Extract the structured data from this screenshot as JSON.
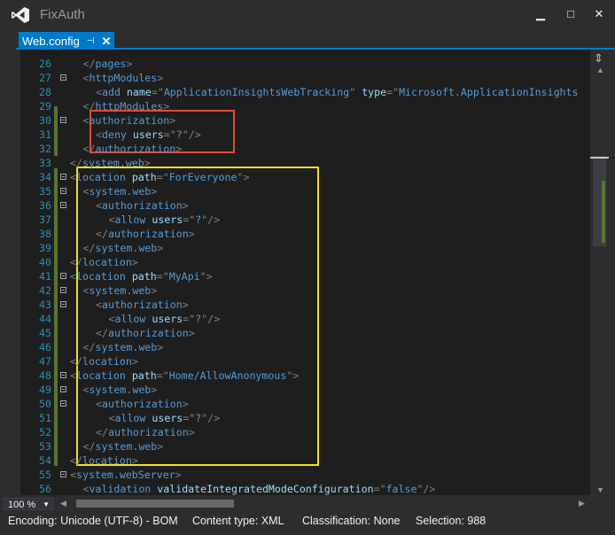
{
  "window": {
    "title": "FixAuth",
    "minimize": "▁",
    "maximize": "□",
    "close": "✕"
  },
  "tab": {
    "label": "Web.config",
    "pin": "⊣",
    "close": "✕"
  },
  "editor": {
    "lines": [
      {
        "n": "26",
        "indent": 2,
        "fold": false,
        "tokens": [
          [
            "p",
            "</"
          ],
          [
            "t",
            "pages"
          ],
          [
            "p",
            ">"
          ]
        ]
      },
      {
        "n": "27",
        "indent": 2,
        "fold": true,
        "tokens": [
          [
            "p",
            "<"
          ],
          [
            "t",
            "httpModules"
          ],
          [
            "p",
            ">"
          ]
        ]
      },
      {
        "n": "28",
        "indent": 3,
        "fold": false,
        "tokens": [
          [
            "p",
            "<"
          ],
          [
            "t",
            "add"
          ],
          [
            "v",
            " "
          ],
          [
            "a",
            "name"
          ],
          [
            "p",
            "=\""
          ],
          [
            "t",
            "ApplicationInsightsWebTracking"
          ],
          [
            "p",
            "\""
          ],
          [
            "v",
            " "
          ],
          [
            "a",
            "type"
          ],
          [
            "p",
            "=\""
          ],
          [
            "t",
            "Microsoft.ApplicationInsights"
          ]
        ]
      },
      {
        "n": "29",
        "indent": 2,
        "fold": false,
        "tokens": [
          [
            "p",
            "</"
          ],
          [
            "t",
            "httpModules"
          ],
          [
            "p",
            ">"
          ]
        ]
      },
      {
        "n": "30",
        "indent": 2,
        "fold": true,
        "tokens": [
          [
            "p",
            "<"
          ],
          [
            "t",
            "authorization"
          ],
          [
            "p",
            ">"
          ]
        ]
      },
      {
        "n": "31",
        "indent": 3,
        "fold": false,
        "tokens": [
          [
            "p",
            "<"
          ],
          [
            "t",
            "deny"
          ],
          [
            "v",
            " "
          ],
          [
            "a",
            "users"
          ],
          [
            "p",
            "=\""
          ],
          [
            "t",
            "?"
          ],
          [
            "p",
            "\"/>"
          ]
        ]
      },
      {
        "n": "32",
        "indent": 2,
        "fold": false,
        "tokens": [
          [
            "p",
            "</"
          ],
          [
            "t",
            "authorization"
          ],
          [
            "p",
            ">"
          ]
        ]
      },
      {
        "n": "33",
        "indent": 1,
        "fold": false,
        "tokens": [
          [
            "p",
            "</"
          ],
          [
            "t",
            "system.web"
          ],
          [
            "p",
            ">"
          ]
        ]
      },
      {
        "n": "34",
        "indent": 1,
        "fold": true,
        "tokens": [
          [
            "p",
            "<"
          ],
          [
            "t",
            "location"
          ],
          [
            "v",
            " "
          ],
          [
            "a",
            "path"
          ],
          [
            "p",
            "=\""
          ],
          [
            "t",
            "ForEveryone"
          ],
          [
            "p",
            "\">"
          ]
        ]
      },
      {
        "n": "35",
        "indent": 2,
        "fold": true,
        "tokens": [
          [
            "p",
            "<"
          ],
          [
            "t",
            "system.web"
          ],
          [
            "p",
            ">"
          ]
        ]
      },
      {
        "n": "36",
        "indent": 3,
        "fold": true,
        "tokens": [
          [
            "p",
            "<"
          ],
          [
            "t",
            "authorization"
          ],
          [
            "p",
            ">"
          ]
        ]
      },
      {
        "n": "37",
        "indent": 4,
        "fold": false,
        "tokens": [
          [
            "p",
            "<"
          ],
          [
            "t",
            "allow"
          ],
          [
            "v",
            " "
          ],
          [
            "a",
            "users"
          ],
          [
            "p",
            "=\""
          ],
          [
            "t",
            "?"
          ],
          [
            "p",
            "\"/>"
          ]
        ]
      },
      {
        "n": "38",
        "indent": 3,
        "fold": false,
        "tokens": [
          [
            "p",
            "</"
          ],
          [
            "t",
            "authorization"
          ],
          [
            "p",
            ">"
          ]
        ]
      },
      {
        "n": "39",
        "indent": 2,
        "fold": false,
        "tokens": [
          [
            "p",
            "</"
          ],
          [
            "t",
            "system.web"
          ],
          [
            "p",
            ">"
          ]
        ]
      },
      {
        "n": "40",
        "indent": 1,
        "fold": false,
        "tokens": [
          [
            "p",
            "</"
          ],
          [
            "t",
            "location"
          ],
          [
            "p",
            ">"
          ]
        ]
      },
      {
        "n": "41",
        "indent": 1,
        "fold": true,
        "tokens": [
          [
            "p",
            "<"
          ],
          [
            "t",
            "location"
          ],
          [
            "v",
            " "
          ],
          [
            "a",
            "path"
          ],
          [
            "p",
            "=\""
          ],
          [
            "t",
            "MyApi"
          ],
          [
            "p",
            "\">"
          ]
        ]
      },
      {
        "n": "42",
        "indent": 2,
        "fold": true,
        "tokens": [
          [
            "p",
            "<"
          ],
          [
            "t",
            "system.web"
          ],
          [
            "p",
            ">"
          ]
        ]
      },
      {
        "n": "43",
        "indent": 3,
        "fold": true,
        "tokens": [
          [
            "p",
            "<"
          ],
          [
            "t",
            "authorization"
          ],
          [
            "p",
            ">"
          ]
        ]
      },
      {
        "n": "44",
        "indent": 4,
        "fold": false,
        "tokens": [
          [
            "p",
            "<"
          ],
          [
            "t",
            "allow"
          ],
          [
            "v",
            " "
          ],
          [
            "a",
            "users"
          ],
          [
            "p",
            "=\""
          ],
          [
            "t",
            "?"
          ],
          [
            "p",
            "\"/>"
          ]
        ]
      },
      {
        "n": "45",
        "indent": 3,
        "fold": false,
        "tokens": [
          [
            "p",
            "</"
          ],
          [
            "t",
            "authorization"
          ],
          [
            "p",
            ">"
          ]
        ]
      },
      {
        "n": "46",
        "indent": 2,
        "fold": false,
        "tokens": [
          [
            "p",
            "</"
          ],
          [
            "t",
            "system.web"
          ],
          [
            "p",
            ">"
          ]
        ]
      },
      {
        "n": "47",
        "indent": 1,
        "fold": false,
        "tokens": [
          [
            "p",
            "</"
          ],
          [
            "t",
            "location"
          ],
          [
            "p",
            ">"
          ]
        ]
      },
      {
        "n": "48",
        "indent": 1,
        "fold": true,
        "tokens": [
          [
            "p",
            "<"
          ],
          [
            "t",
            "location"
          ],
          [
            "v",
            " "
          ],
          [
            "a",
            "path"
          ],
          [
            "p",
            "=\""
          ],
          [
            "t",
            "Home/AllowAnonymous"
          ],
          [
            "p",
            "\">"
          ]
        ]
      },
      {
        "n": "49",
        "indent": 2,
        "fold": true,
        "tokens": [
          [
            "p",
            "<"
          ],
          [
            "t",
            "system.web"
          ],
          [
            "p",
            ">"
          ]
        ]
      },
      {
        "n": "50",
        "indent": 3,
        "fold": true,
        "tokens": [
          [
            "p",
            "<"
          ],
          [
            "t",
            "authorization"
          ],
          [
            "p",
            ">"
          ]
        ]
      },
      {
        "n": "51",
        "indent": 4,
        "fold": false,
        "tokens": [
          [
            "p",
            "<"
          ],
          [
            "t",
            "allow"
          ],
          [
            "v",
            " "
          ],
          [
            "a",
            "users"
          ],
          [
            "p",
            "=\""
          ],
          [
            "t",
            "?"
          ],
          [
            "p",
            "\"/>"
          ]
        ]
      },
      {
        "n": "52",
        "indent": 3,
        "fold": false,
        "tokens": [
          [
            "p",
            "</"
          ],
          [
            "t",
            "authorization"
          ],
          [
            "p",
            ">"
          ]
        ]
      },
      {
        "n": "53",
        "indent": 2,
        "fold": false,
        "tokens": [
          [
            "p",
            "</"
          ],
          [
            "t",
            "system.web"
          ],
          [
            "p",
            ">"
          ]
        ]
      },
      {
        "n": "54",
        "indent": 1,
        "fold": false,
        "tokens": [
          [
            "p",
            "</"
          ],
          [
            "t",
            "location"
          ],
          [
            "p",
            ">"
          ]
        ]
      },
      {
        "n": "55",
        "indent": 1,
        "fold": true,
        "tokens": [
          [
            "p",
            "<"
          ],
          [
            "t",
            "system.webServer"
          ],
          [
            "p",
            ">"
          ]
        ]
      },
      {
        "n": "56",
        "indent": 2,
        "fold": false,
        "tokens": [
          [
            "p",
            "<"
          ],
          [
            "t",
            "validation"
          ],
          [
            "v",
            " "
          ],
          [
            "a",
            "validateIntegratedModeConfiguration"
          ],
          [
            "p",
            "=\""
          ],
          [
            "t",
            "false"
          ],
          [
            "p",
            "\"/>"
          ]
        ]
      }
    ]
  },
  "zoom": {
    "value": "100 %"
  },
  "status": {
    "encoding": "Encoding: Unicode (UTF-8) - BOM",
    "content_type": "Content type: XML",
    "classification": "Classification: None",
    "selection": "Selection: 988"
  },
  "colors": {
    "accent": "#007acc",
    "red_highlight": "#e04d3a",
    "yellow_highlight": "#f0e020",
    "change_bar": "#577430"
  }
}
